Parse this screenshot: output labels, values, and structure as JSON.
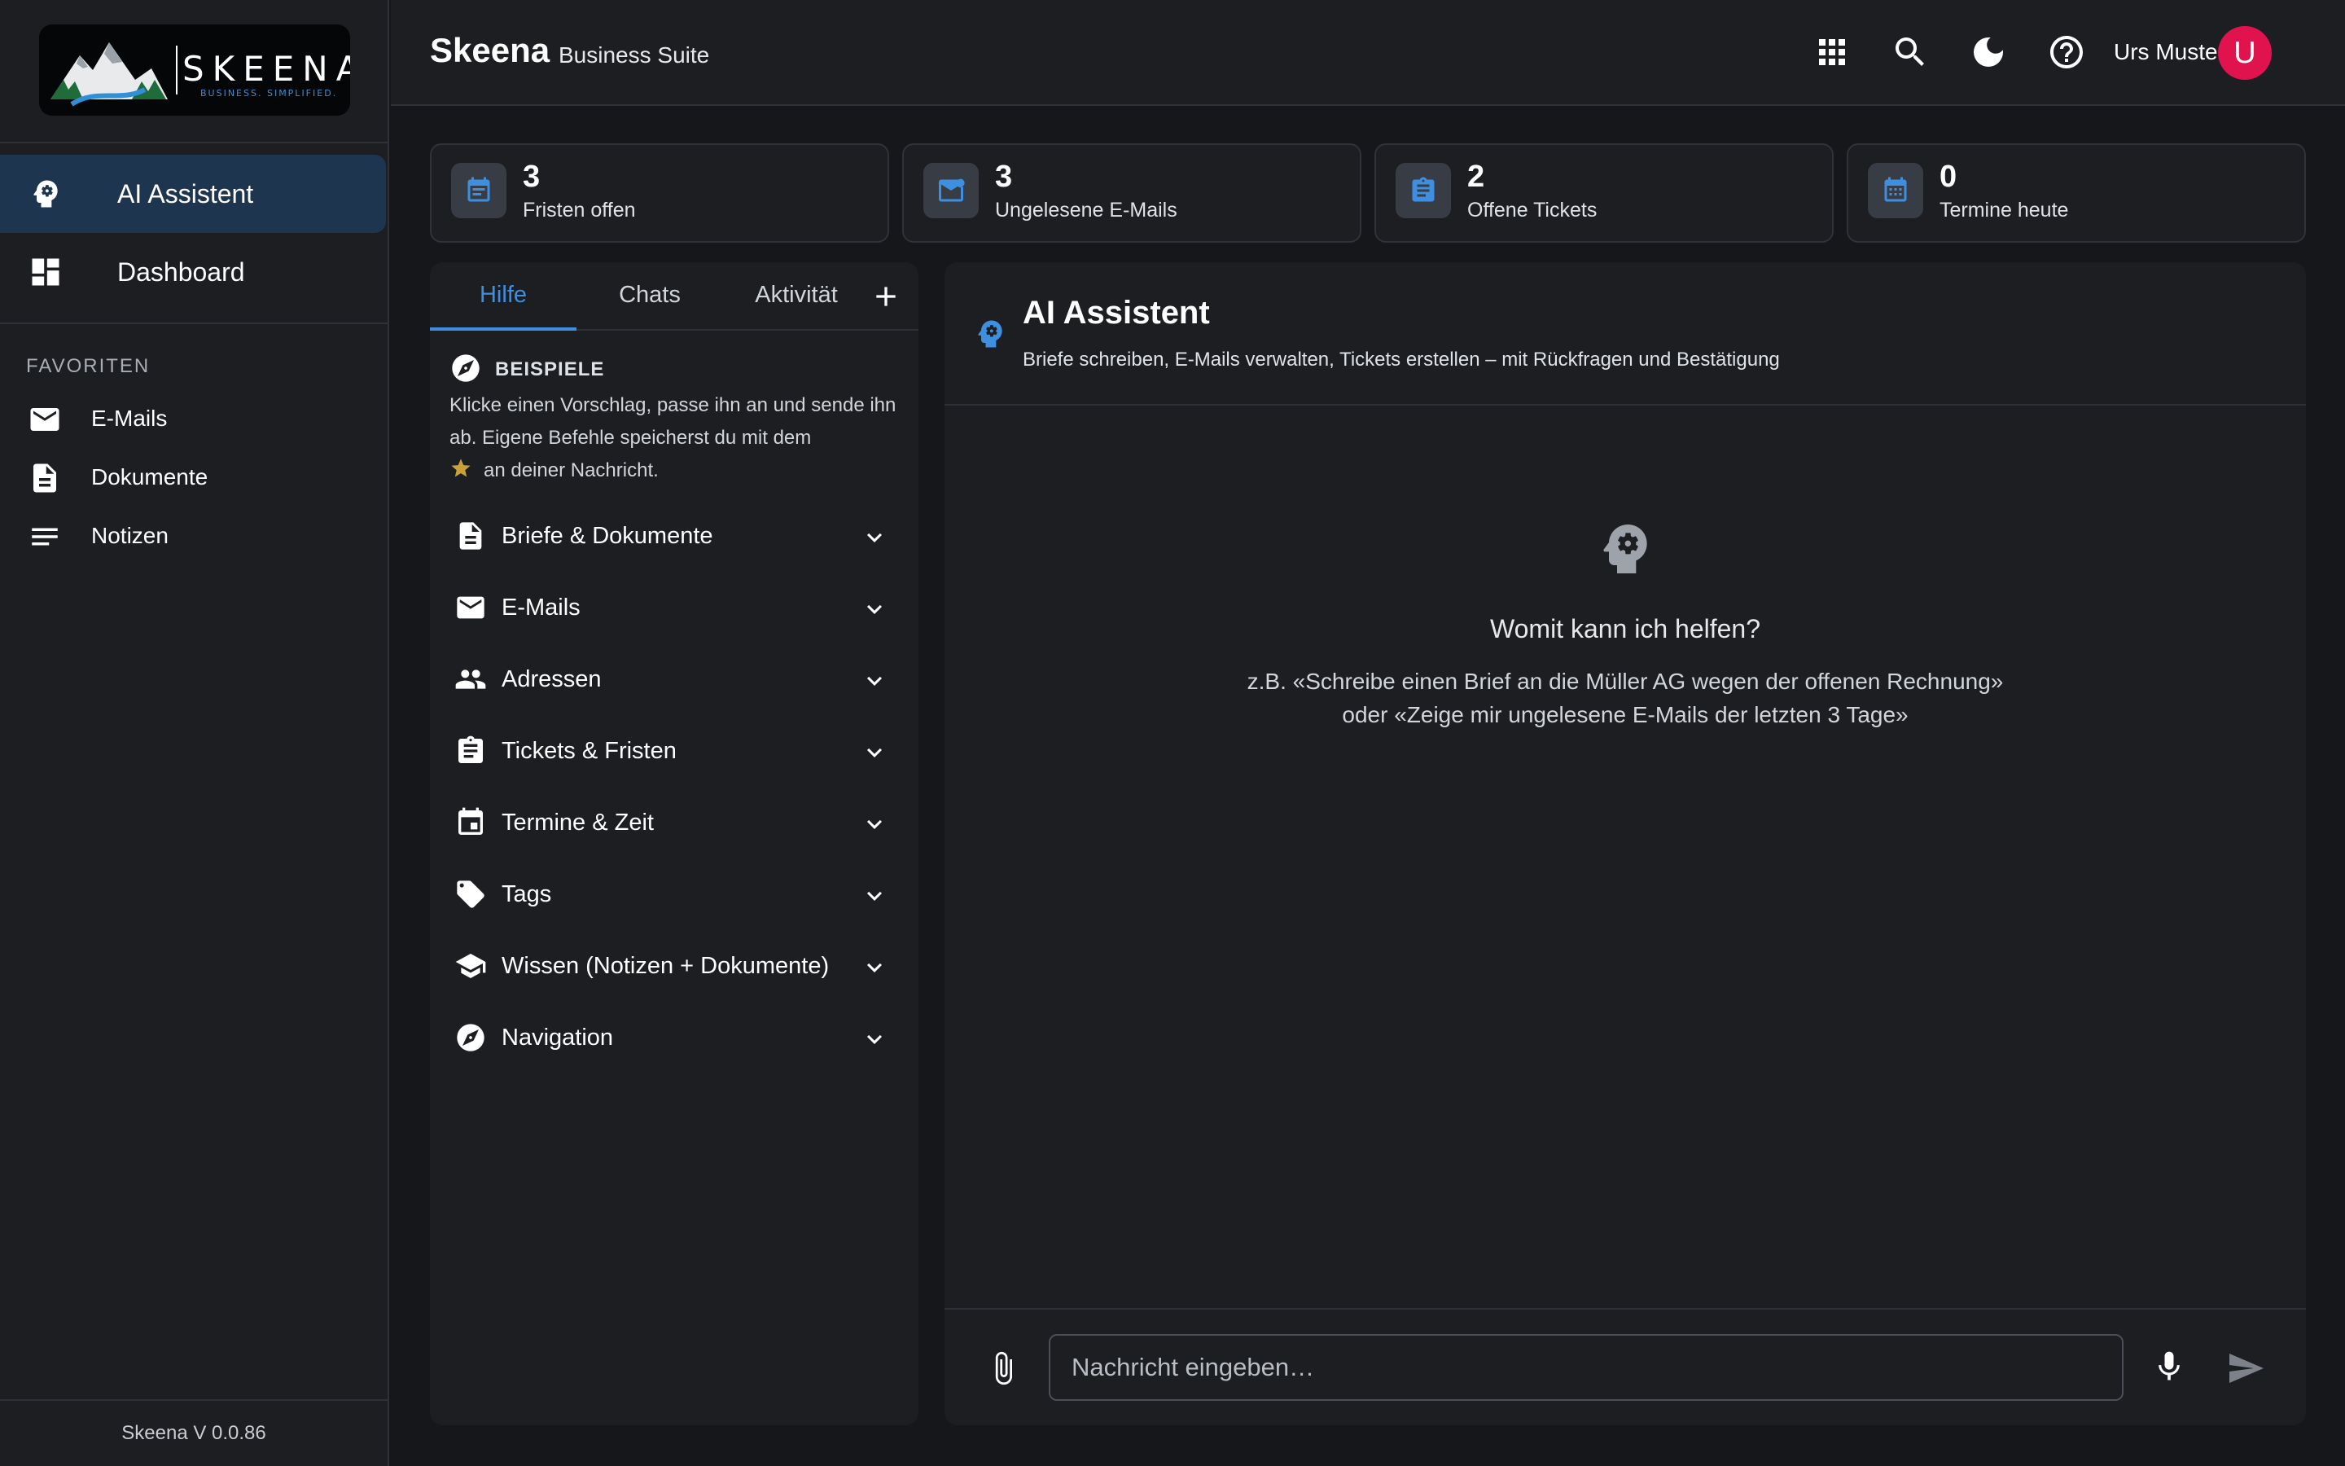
{
  "sidebar": {
    "logo": {
      "word": "SKEENA",
      "tagline": "BUSINESS. SIMPLIFIED."
    },
    "nav": [
      {
        "label": "AI Assistent",
        "icon": "ai-head-icon",
        "active": true
      },
      {
        "label": "Dashboard",
        "icon": "dashboard-icon",
        "active": false
      }
    ],
    "favorites_heading": "FAVORITEN",
    "favorites": [
      {
        "label": "E-Mails",
        "icon": "mail-icon"
      },
      {
        "label": "Dokumente",
        "icon": "document-icon"
      },
      {
        "label": "Notizen",
        "icon": "notes-icon"
      }
    ],
    "version": "Skeena V 0.0.86"
  },
  "header": {
    "title": "Skeena",
    "subtitle": "Business Suite",
    "icons": [
      "apps-grid-icon",
      "search-icon",
      "dark-mode-icon",
      "help-icon"
    ],
    "user_name": "Urs Muster",
    "avatar_initial": "U",
    "avatar_color": "#e0134f"
  },
  "stats": [
    {
      "value": "3",
      "label": "Fristen offen",
      "icon": "calendar-note-icon"
    },
    {
      "value": "3",
      "label": "Ungelesene E-Mails",
      "icon": "mail-unread-icon"
    },
    {
      "value": "2",
      "label": "Offene Tickets",
      "icon": "clipboard-icon"
    },
    {
      "value": "0",
      "label": "Termine heute",
      "icon": "calendar-grid-icon"
    }
  ],
  "left_panel": {
    "tabs": [
      {
        "label": "Hilfe",
        "active": true
      },
      {
        "label": "Chats",
        "active": false
      },
      {
        "label": "Aktivität",
        "active": false
      }
    ],
    "examples_title": "BEISPIELE",
    "examples_text": "Klicke einen Vorschlag, passe ihn an und sende ihn ab. Eigene Befehle speicherst du mit dem",
    "examples_text_end": "an deiner Nachricht.",
    "categories": [
      {
        "label": "Briefe & Dokumente",
        "icon": "document-icon"
      },
      {
        "label": "E-Mails",
        "icon": "mail-icon"
      },
      {
        "label": "Adressen",
        "icon": "people-icon"
      },
      {
        "label": "Tickets & Fristen",
        "icon": "clipboard-icon"
      },
      {
        "label": "Termine & Zeit",
        "icon": "calendar-icon"
      },
      {
        "label": "Tags",
        "icon": "tag-icon"
      },
      {
        "label": "Wissen (Notizen + Dokumente)",
        "icon": "school-icon"
      },
      {
        "label": "Navigation",
        "icon": "compass-icon"
      }
    ]
  },
  "main": {
    "title": "AI Assistent",
    "subtitle": "Briefe schreiben, E-Mails verwalten, Tickets erstellen – mit Rückfragen und Bestätigung",
    "empty_title": "Womit kann ich helfen?",
    "empty_hint_1": "z.B. «Schreibe einen Brief an die Müller AG wegen der offenen Rechnung»",
    "empty_hint_2": "oder «Zeige mir ungelesene E-Mails der letzten 3 Tage»",
    "input_placeholder": "Nachricht eingeben…",
    "accent_color": "#3f8fe0"
  }
}
